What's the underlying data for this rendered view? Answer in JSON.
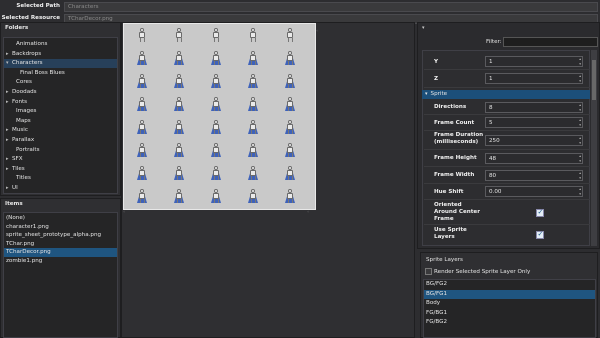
{
  "selected_path": {
    "label": "Selected Path",
    "value": "Characters"
  },
  "selected_resource": {
    "label": "Selected Resource",
    "value": "TCharDecor.png"
  },
  "folders": {
    "title": "Folders",
    "items": [
      {
        "label": "Animations",
        "arrow": "",
        "indent": 1
      },
      {
        "label": "Backdrops",
        "arrow": "▸",
        "indent": 0
      },
      {
        "label": "Characters",
        "arrow": "▾",
        "indent": 0,
        "selected": true
      },
      {
        "label": "Final Boss Blues",
        "arrow": "",
        "indent": 2
      },
      {
        "label": "Cores",
        "arrow": "",
        "indent": 1
      },
      {
        "label": "Doodads",
        "arrow": "▸",
        "indent": 0
      },
      {
        "label": "Fonts",
        "arrow": "▸",
        "indent": 0
      },
      {
        "label": "Images",
        "arrow": "",
        "indent": 1
      },
      {
        "label": "Maps",
        "arrow": "",
        "indent": 1
      },
      {
        "label": "Music",
        "arrow": "▸",
        "indent": 0
      },
      {
        "label": "Parallax",
        "arrow": "▸",
        "indent": 0
      },
      {
        "label": "Portraits",
        "arrow": "",
        "indent": 1
      },
      {
        "label": "SFX",
        "arrow": "▸",
        "indent": 0
      },
      {
        "label": "Tiles",
        "arrow": "▸",
        "indent": 0
      },
      {
        "label": "Titles",
        "arrow": "",
        "indent": 1
      },
      {
        "label": "UI",
        "arrow": "▸",
        "indent": 0
      }
    ]
  },
  "items": {
    "title": "Items",
    "entries": [
      "(None)",
      "character1.png",
      "sprite_sheet_prototype_alpha.png",
      "TChar.png",
      "TCharDecor.png",
      "zombie1.png"
    ],
    "selected_index": 4
  },
  "filter": {
    "label": "Filter:",
    "value": ""
  },
  "properties": {
    "y": {
      "label": "Y",
      "value": "1"
    },
    "z": {
      "label": "Z",
      "value": "1"
    },
    "sprite_section": "Sprite",
    "directions": {
      "label": "Directions",
      "value": "8"
    },
    "frame_count": {
      "label": "Frame Count",
      "value": "5"
    },
    "frame_duration": {
      "label": "Frame Duration (milliseconds)",
      "value": "250"
    },
    "frame_height": {
      "label": "Frame Height",
      "value": "48"
    },
    "frame_width": {
      "label": "Frame Width",
      "value": "80"
    },
    "hue_shift": {
      "label": "Hue Shift",
      "value": "0.00"
    },
    "oriented": {
      "label": "Oriented Around Center Frame",
      "checked": true
    },
    "use_sprite_layers": {
      "label": "Use Sprite Layers",
      "checked": true
    }
  },
  "sprite_layers": {
    "title": "Sprite Layers",
    "render_selected_label": "Render Selected Sprite Layer Only",
    "layers": [
      "BG/FG2",
      "BG/FG1",
      "Body",
      "FG/BG1",
      "FG/BG2"
    ],
    "selected_index": 1
  },
  "sprite_grid": {
    "columns": 5,
    "rows": 8,
    "accent": "#2f57b8"
  },
  "colors": {
    "selection": "#1f5580",
    "section": "#1c4f7a"
  }
}
